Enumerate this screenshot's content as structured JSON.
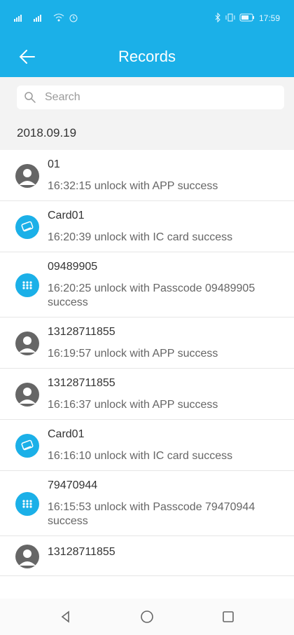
{
  "status": {
    "time": "17:59"
  },
  "header": {
    "title": "Records"
  },
  "search": {
    "placeholder": "Search"
  },
  "section": {
    "date": "2018.09.19"
  },
  "records": [
    {
      "name": "01",
      "desc": "16:32:15 unlock with APP success",
      "icon": "user-avatar-icon"
    },
    {
      "name": "Card01",
      "desc": "16:20:39 unlock with IC card success",
      "icon": "card-icon"
    },
    {
      "name": "09489905",
      "desc": "16:20:25 unlock with Passcode 09489905 success",
      "icon": "keypad-icon"
    },
    {
      "name": "13128711855",
      "desc": "16:19:57 unlock with APP success",
      "icon": "user-avatar-icon"
    },
    {
      "name": "13128711855",
      "desc": "16:16:37 unlock with APP success",
      "icon": "user-avatar-icon"
    },
    {
      "name": "Card01",
      "desc": "16:16:10 unlock with IC card success",
      "icon": "card-icon"
    },
    {
      "name": "79470944",
      "desc": "16:15:53 unlock with Passcode 79470944 success",
      "icon": "keypad-icon"
    },
    {
      "name": "13128711855",
      "desc": "",
      "icon": "user-avatar-icon"
    }
  ],
  "colors": {
    "accent": "#1bb0e8",
    "avatar_gray": "#666666"
  }
}
